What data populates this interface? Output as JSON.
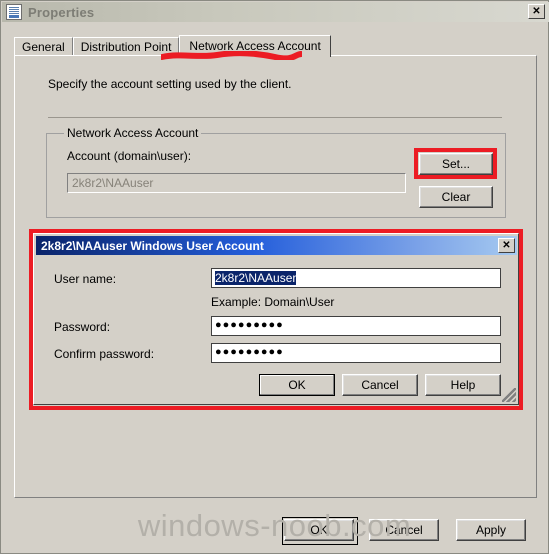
{
  "window": {
    "title": "Properties",
    "icon": "properties-icon",
    "close_label": "✕"
  },
  "tabs": [
    {
      "label": "General",
      "selected": false
    },
    {
      "label": "Distribution Point",
      "selected": false
    },
    {
      "label": "Network Access Account",
      "selected": true
    }
  ],
  "main": {
    "intro": "Specify the account setting used by the client.",
    "group": {
      "legend": "Network Access Account",
      "account_label": "Account (domain\\user):",
      "account_value": "2k8r2\\NAAuser",
      "set_button": "Set...",
      "clear_button": "Clear"
    }
  },
  "dialog_buttons": {
    "ok": "OK",
    "cancel": "Cancel",
    "apply": "Apply"
  },
  "inner_dialog": {
    "title": "2k8r2\\NAAuser Windows User Account",
    "close_label": "✕",
    "username_label": "User name:",
    "username_value": "2k8r2\\NAAuser",
    "username_hint": "Example: Domain\\User",
    "password_label": "Password:",
    "password_value": "●●●●●●●●●",
    "confirm_label": "Confirm password:",
    "confirm_value": "●●●●●●●●●",
    "ok": "OK",
    "cancel": "Cancel",
    "help": "Help"
  },
  "annotations": {
    "color": "#ec1c24",
    "set_button_highlight": "Set...",
    "dialog_highlight": "2k8r2\\NAAuser Windows User Account",
    "tab_underline": "Network Access Account"
  },
  "watermark": "windows-noob.com"
}
